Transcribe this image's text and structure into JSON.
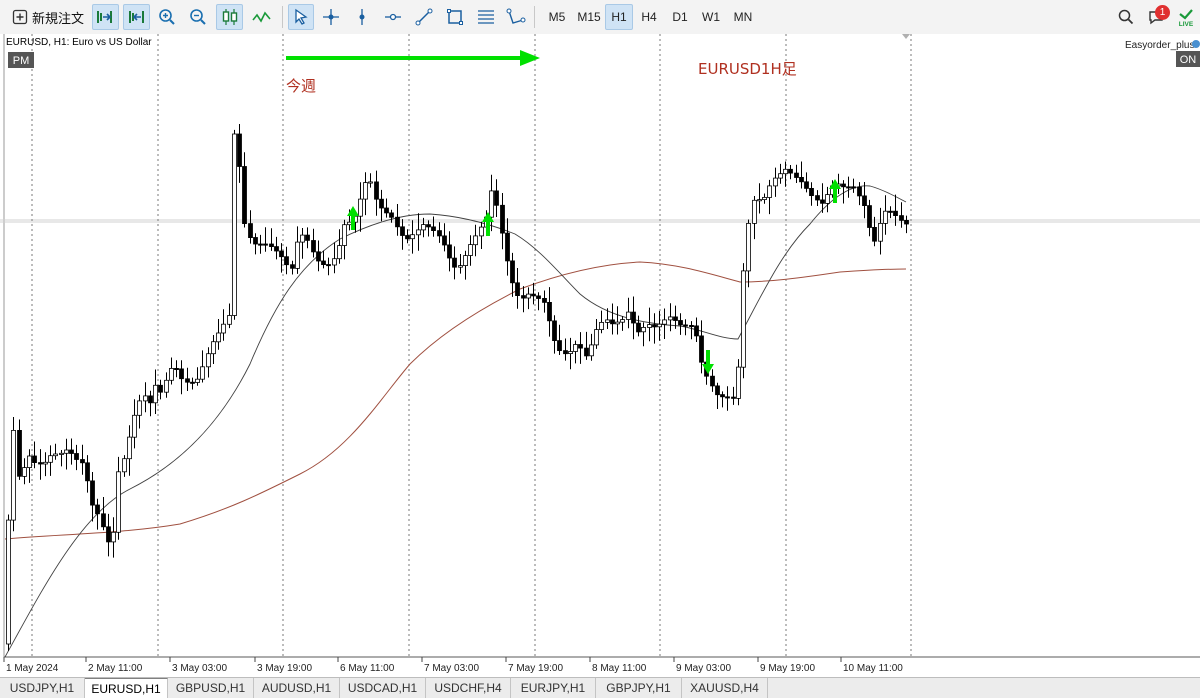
{
  "toolbar": {
    "new_order_label": "新規注文",
    "timeframes": [
      "M5",
      "M15",
      "H1",
      "H4",
      "D1",
      "W1",
      "MN"
    ],
    "active_timeframe": "H1",
    "notification_count": "1",
    "icons": [
      "new-order-icon",
      "auto-scroll-icon",
      "chart-shift-icon",
      "zoom-in-icon",
      "zoom-out-icon",
      "candlestick-icon",
      "line-chart-icon",
      "cursor-icon",
      "crosshair-icon",
      "vertical-line-icon",
      "horizontal-line-icon",
      "trend-line-icon",
      "rectangle-icon",
      "fibonacci-icon",
      "channel-icon",
      "search-icon",
      "notifications-icon",
      "live-icon"
    ]
  },
  "chart": {
    "symbol_info": "EURUSD, H1:  Euro vs US Dollar",
    "pm_label": "PM",
    "on_label": "ON",
    "ea_label": "Easyorder_plus",
    "annotation_week": "今週",
    "annotation_title": "EURUSD1H足",
    "colors": {
      "annotation_text": "#b03020",
      "arrow": "#00e000",
      "candle": "#000000",
      "ma_fast": "#404040",
      "ma_slow": "#a05040",
      "grid_dashed": "#808080"
    },
    "x_labels": [
      "1 May 2024",
      "2 May 11:00",
      "3 May 03:00",
      "3 May 19:00",
      "6 May 11:00",
      "7 May 03:00",
      "7 May 19:00",
      "8 May 11:00",
      "9 May 03:00",
      "9 May 19:00",
      "10 May 11:00"
    ]
  },
  "tabs": [
    "USDJPY,H1",
    "EURUSD,H1",
    "GBPUSD,H1",
    "AUDUSD,H1",
    "USDCAD,H1",
    "USDCHF,H4",
    "EURJPY,H1",
    "GBPJPY,H1",
    "XAUUSD,H4"
  ],
  "active_tab": "EURUSD,H1"
}
